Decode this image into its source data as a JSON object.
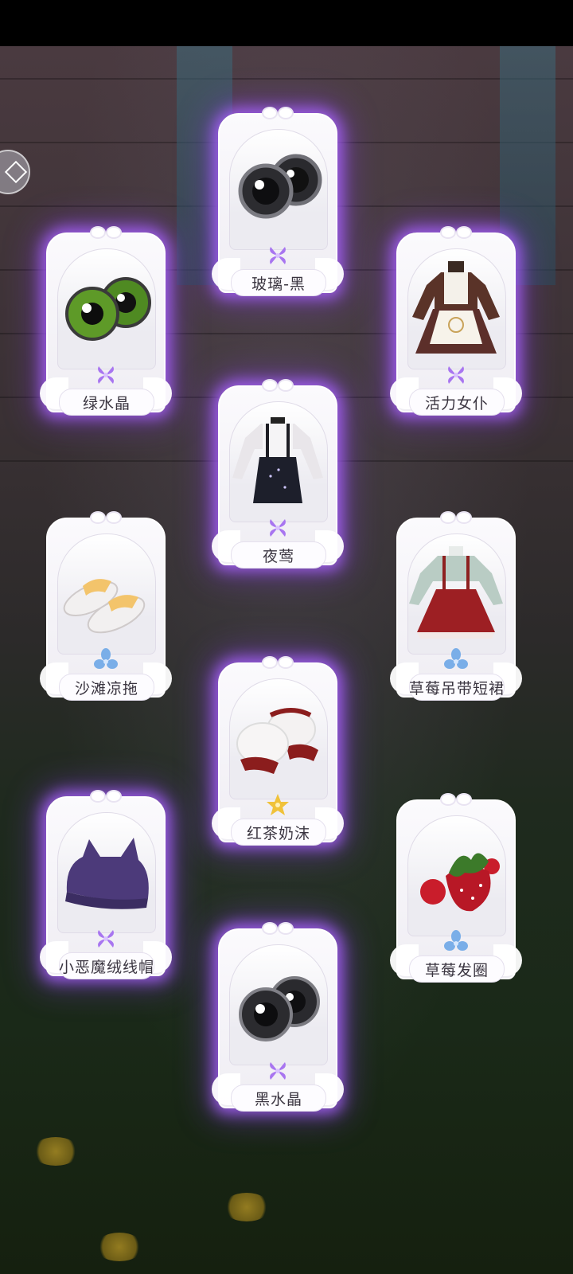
{
  "items": [
    {
      "name": "玻璃-黑",
      "rarity": "purple",
      "icon": "black-eye-lens-icon"
    },
    {
      "name": "绿水晶",
      "rarity": "purple",
      "icon": "green-eye-lens-icon"
    },
    {
      "name": "活力女仆",
      "rarity": "purple",
      "icon": "maid-dress-icon"
    },
    {
      "name": "夜莺",
      "rarity": "purple",
      "icon": "nightingale-outfit-icon"
    },
    {
      "name": "沙滩凉拖",
      "rarity": "blue",
      "icon": "beach-slippers-icon"
    },
    {
      "name": "草莓吊带短裙",
      "rarity": "blue",
      "icon": "strawberry-suspender-skirt-icon"
    },
    {
      "name": "红茶奶沫",
      "rarity": "gold",
      "icon": "tea-foam-cuffs-icon"
    },
    {
      "name": "小恶魔绒线帽",
      "rarity": "purple",
      "icon": "devil-knit-hat-icon"
    },
    {
      "name": "草莓发圈",
      "rarity": "blue",
      "icon": "strawberry-scrunchie-icon"
    },
    {
      "name": "黑水晶",
      "rarity": "purple",
      "icon": "black-crystal-eye-icon"
    }
  ],
  "colors": {
    "purple": "#a875f0",
    "blue": "#7aaee8",
    "gold": "#f0c23a",
    "glow": "#aa64ff"
  }
}
